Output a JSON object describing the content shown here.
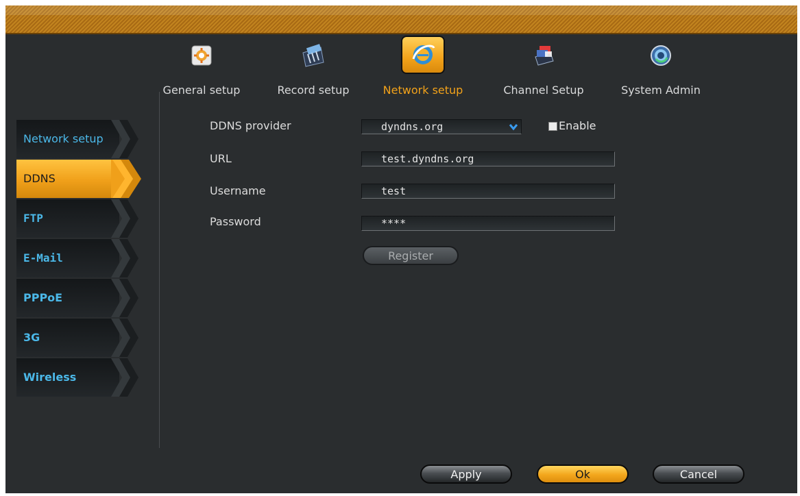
{
  "nav": {
    "items": [
      {
        "label": "General setup",
        "icon": "general-setup-icon"
      },
      {
        "label": "Record setup",
        "icon": "record-setup-icon"
      },
      {
        "label": "Network setup",
        "icon": "network-setup-icon",
        "active": true
      },
      {
        "label": "Channel Setup",
        "icon": "channel-setup-icon"
      },
      {
        "label": "System Admin",
        "icon": "system-admin-icon"
      }
    ]
  },
  "sidebar": {
    "items": [
      {
        "label": "Network setup"
      },
      {
        "label": "DDNS",
        "active": true
      },
      {
        "label": "FTP"
      },
      {
        "label": "E-Mail"
      },
      {
        "label": "PPPoE"
      },
      {
        "label": "3G"
      },
      {
        "label": "Wireless"
      }
    ]
  },
  "form": {
    "ddns_provider_label": "DDNS provider",
    "ddns_provider_value": "dyndns.org",
    "enable_label": "Enable",
    "enable_checked": false,
    "url_label": "URL",
    "url_value": "test.dyndns.org",
    "username_label": "Username",
    "username_value": "test",
    "password_label": "Password",
    "password_value": "****",
    "register_label": "Register"
  },
  "footer": {
    "apply_label": "Apply",
    "ok_label": "Ok",
    "cancel_label": "Cancel"
  },
  "colors": {
    "accent": "#f2a21a",
    "sidebar_text": "#4bb8e8",
    "background": "#2a2d2f"
  }
}
